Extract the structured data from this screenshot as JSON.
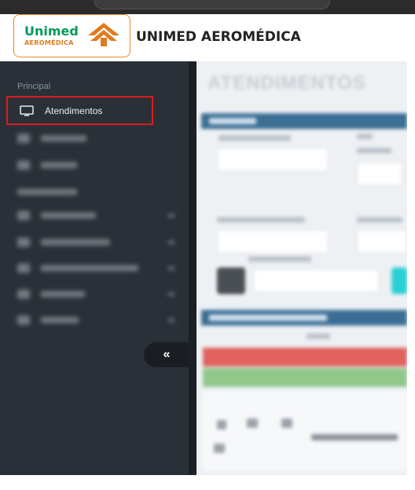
{
  "header": {
    "logo_line1": "Unimed",
    "logo_line2": "AEROMÉDICA",
    "app_title": "UNIMED AEROMÉDICA"
  },
  "sidebar": {
    "section_label": "Principal",
    "items": [
      {
        "label": "Atendimentos",
        "icon": "monitor-icon",
        "active": true
      }
    ],
    "collapse_label": "«"
  },
  "content": {
    "title": "ATENDIMENTOS"
  },
  "colors": {
    "brand_green": "#00995d",
    "brand_orange": "#e07a1f",
    "sidebar_bg": "#2a3038",
    "active_outline": "#e0191e"
  }
}
